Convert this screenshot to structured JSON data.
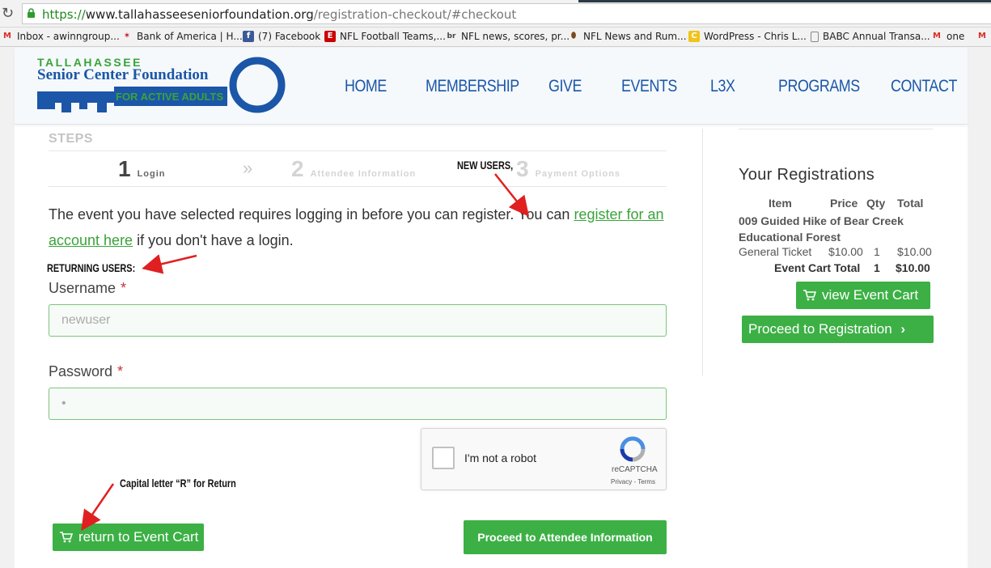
{
  "browser": {
    "url_scheme": "https://",
    "url_host": "www.tallahasseeseniorfoundation.org",
    "url_path": "/registration-checkout/#checkout",
    "bookmarks": [
      {
        "label": "Inbox - awinngroup...",
        "icon": "gmail-icon"
      },
      {
        "label": "Bank of America | H...",
        "icon": "bank-of-america-icon"
      },
      {
        "label": "(7) Facebook",
        "icon": "facebook-icon"
      },
      {
        "label": "NFL Football Teams,...",
        "icon": "espn-icon"
      },
      {
        "label": "NFL news, scores, pr...",
        "icon": "bleacher-report-icon"
      },
      {
        "label": "NFL News and Rum...",
        "icon": "football-icon"
      },
      {
        "label": "WordPress - Chris L...",
        "icon": "wordpress-icon"
      },
      {
        "label": "BABC Annual Transa...",
        "icon": "document-icon"
      },
      {
        "label": "one",
        "icon": "gmail-icon"
      }
    ]
  },
  "logo": {
    "line1": "TALLAHASSEE",
    "line2": "Senior Center Foundation",
    "line3": "FOR ACTIVE ADULTS"
  },
  "nav": [
    "HOME",
    "MEMBERSHIP",
    "GIVE",
    "EVENTS",
    "L3X",
    "PROGRAMS",
    "CONTACT"
  ],
  "steps": {
    "title": "STEPS",
    "items": [
      {
        "num": "1",
        "label": "Login"
      },
      {
        "num": "2",
        "label": "Attendee Information"
      },
      {
        "num": "3",
        "label": "Payment Options"
      }
    ],
    "separator": "»"
  },
  "message": {
    "before": "The event you have selected requires logging in before you can register. You can ",
    "link": "register for an account here",
    "after": " if you don't have a login."
  },
  "form": {
    "username_label": "Username",
    "username_value": "newuser",
    "password_label": "Password",
    "password_value": "•",
    "required_mark": "*"
  },
  "recaptcha": {
    "label": "I'm not a robot",
    "brand": "reCAPTCHA",
    "links": "Privacy - Terms"
  },
  "buttons": {
    "return_cart": "return to Event Cart",
    "proceed_attendee": "Proceed to Attendee Information",
    "view_cart": "view Event Cart",
    "proceed_registration": "Proceed to Registration"
  },
  "sidebar": {
    "title": "Your Registrations",
    "headers": {
      "item": "Item",
      "price": "Price",
      "qty": "Qty",
      "total": "Total"
    },
    "event_name": "009 Guided Hike of Bear Creek Educational Forest",
    "ticket": {
      "name": "General Ticket",
      "price": "$10.00",
      "qty": "1",
      "total": "$10.00"
    },
    "cart_total": {
      "label": "Event Cart Total",
      "qty": "1",
      "total": "$10.00"
    }
  },
  "annotations": {
    "new_users": "NEW USERS,",
    "returning_users": "RETURNING USERS:",
    "capital_r": "Capital letter “R” for Return"
  },
  "colors": {
    "brand_blue": "#1b56a8",
    "brand_green": "#3aa33a",
    "button_green": "#3cb045",
    "required_red": "#c9303c",
    "arrow_red": "#e02020"
  }
}
